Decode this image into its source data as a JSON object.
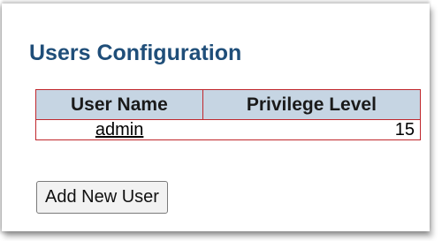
{
  "page": {
    "title": "Users Configuration"
  },
  "users_table": {
    "columns": [
      "User Name",
      "Privilege Level"
    ],
    "rows": [
      {
        "user_name": "admin",
        "privilege_level": "15"
      }
    ]
  },
  "actions": {
    "add_user_label": "Add New User"
  },
  "colors": {
    "title": "#1f4e79",
    "header_bg": "#c6d5e3",
    "table_border": "#c0272d"
  }
}
